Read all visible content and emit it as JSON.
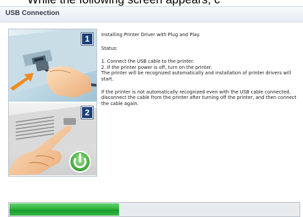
{
  "caption": {
    "text": "While the following screen appears, c"
  },
  "window": {
    "title": "USB Connection"
  },
  "illustration": {
    "step1_number": "1",
    "step2_number": "2",
    "panel1_icon": "usb-plug-icon",
    "panel2_icon": "power-button-icon"
  },
  "instructions": {
    "heading": "Installing Printer Driver with Plug and Play.",
    "status_label": "Status:",
    "step1": "1. Connect the USB cable to the printer.",
    "step2": "2. If the printer power is off, turn on the printer.",
    "step2_detail": "The printer will be recognized automatically and installation of printer drivers will start.",
    "note": "If the printer is not automatically recognized even with the USB cable connected, disconnect the cable from the printer after turning off the printer, and then connect the cable again."
  },
  "progress": {
    "fraction": 0.38
  },
  "colors": {
    "accent_green": "#2fb33d",
    "badge_blue": "#1c3f7a",
    "power_icon_green": "#3fae3a"
  }
}
